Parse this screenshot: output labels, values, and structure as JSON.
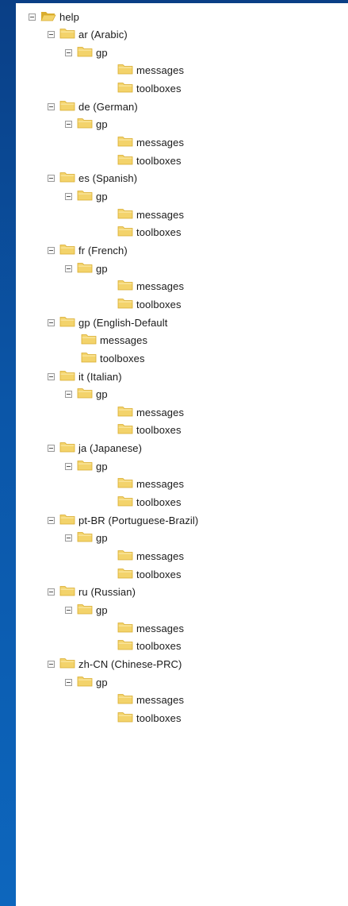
{
  "tree": {
    "root": {
      "label": "help",
      "icon": "folder-open-icon"
    },
    "nodes": [
      {
        "label": "ar (Arabic)",
        "sub": "gp",
        "children": [
          "messages",
          "toolboxes"
        ]
      },
      {
        "label": "de (German)",
        "sub": "gp",
        "children": [
          "messages",
          "toolboxes"
        ]
      },
      {
        "label": "es (Spanish)",
        "sub": "gp",
        "children": [
          "messages",
          "toolboxes"
        ]
      },
      {
        "label": "fr (French)",
        "sub": "gp",
        "children": [
          "messages",
          "toolboxes"
        ]
      },
      {
        "label": "gp (English-Default",
        "sub": null,
        "children": [
          "messages",
          "toolboxes"
        ]
      },
      {
        "label": "it (Italian)",
        "sub": "gp",
        "children": [
          "messages",
          "toolboxes"
        ]
      },
      {
        "label": "ja (Japanese)",
        "sub": "gp",
        "children": [
          "messages",
          "toolboxes"
        ]
      },
      {
        "label": "pt-BR (Portuguese-Brazil)",
        "sub": "gp",
        "children": [
          "messages",
          "toolboxes"
        ]
      },
      {
        "label": "ru (Russian)",
        "sub": "gp",
        "children": [
          "messages",
          "toolboxes"
        ]
      },
      {
        "label": "zh-CN (Chinese-PRC)",
        "sub": "gp",
        "children": [
          "messages",
          "toolboxes"
        ]
      }
    ]
  },
  "colors": {
    "folder": "#f3d36b",
    "folder_dark": "#d9ac2e",
    "background": "#0b56a8"
  }
}
